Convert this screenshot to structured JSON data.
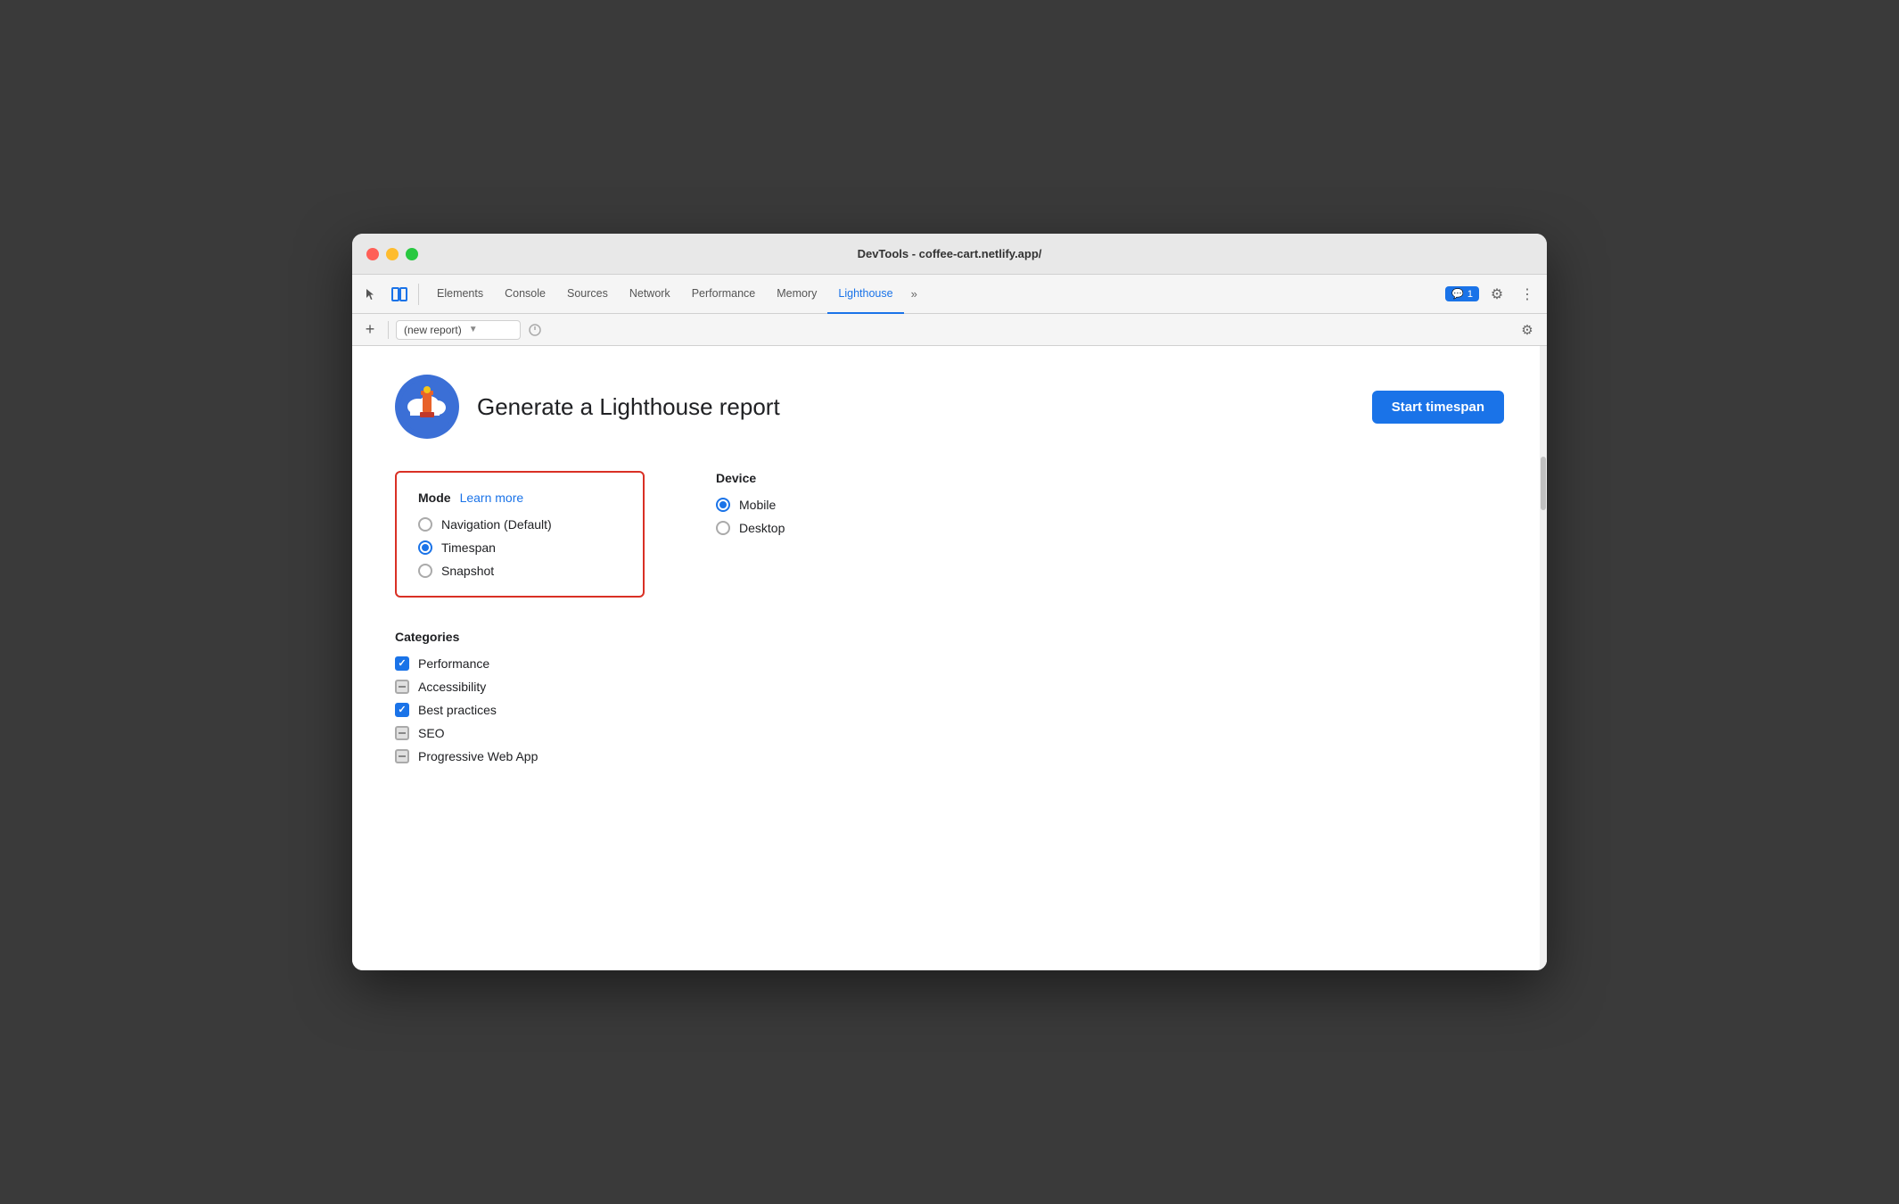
{
  "window": {
    "title": "DevTools - coffee-cart.netlify.app/"
  },
  "tabs": {
    "items": [
      {
        "id": "elements",
        "label": "Elements",
        "active": false
      },
      {
        "id": "console",
        "label": "Console",
        "active": false
      },
      {
        "id": "sources",
        "label": "Sources",
        "active": false
      },
      {
        "id": "network",
        "label": "Network",
        "active": false
      },
      {
        "id": "performance",
        "label": "Performance",
        "active": false
      },
      {
        "id": "memory",
        "label": "Memory",
        "active": false
      },
      {
        "id": "lighthouse",
        "label": "Lighthouse",
        "active": true
      }
    ],
    "more_label": "»",
    "badge_count": "1",
    "settings_tooltip": "Settings",
    "more_options_tooltip": "More options"
  },
  "toolbar": {
    "add_label": "+",
    "report_placeholder": "(new report)",
    "gear_tooltip": "Lighthouse settings"
  },
  "header": {
    "title": "Generate a Lighthouse report",
    "start_button": "Start timespan"
  },
  "mode_section": {
    "label": "Mode",
    "learn_more": "Learn more",
    "options": [
      {
        "id": "navigation",
        "label": "Navigation (Default)",
        "selected": false
      },
      {
        "id": "timespan",
        "label": "Timespan",
        "selected": true
      },
      {
        "id": "snapshot",
        "label": "Snapshot",
        "selected": false
      }
    ]
  },
  "device_section": {
    "label": "Device",
    "options": [
      {
        "id": "mobile",
        "label": "Mobile",
        "selected": true
      },
      {
        "id": "desktop",
        "label": "Desktop",
        "selected": false
      }
    ]
  },
  "categories_section": {
    "label": "Categories",
    "items": [
      {
        "id": "performance",
        "label": "Performance",
        "state": "checked"
      },
      {
        "id": "accessibility",
        "label": "Accessibility",
        "state": "indeterminate"
      },
      {
        "id": "best-practices",
        "label": "Best practices",
        "state": "checked"
      },
      {
        "id": "seo",
        "label": "SEO",
        "state": "indeterminate"
      },
      {
        "id": "pwa",
        "label": "Progressive Web App",
        "state": "indeterminate"
      }
    ]
  }
}
